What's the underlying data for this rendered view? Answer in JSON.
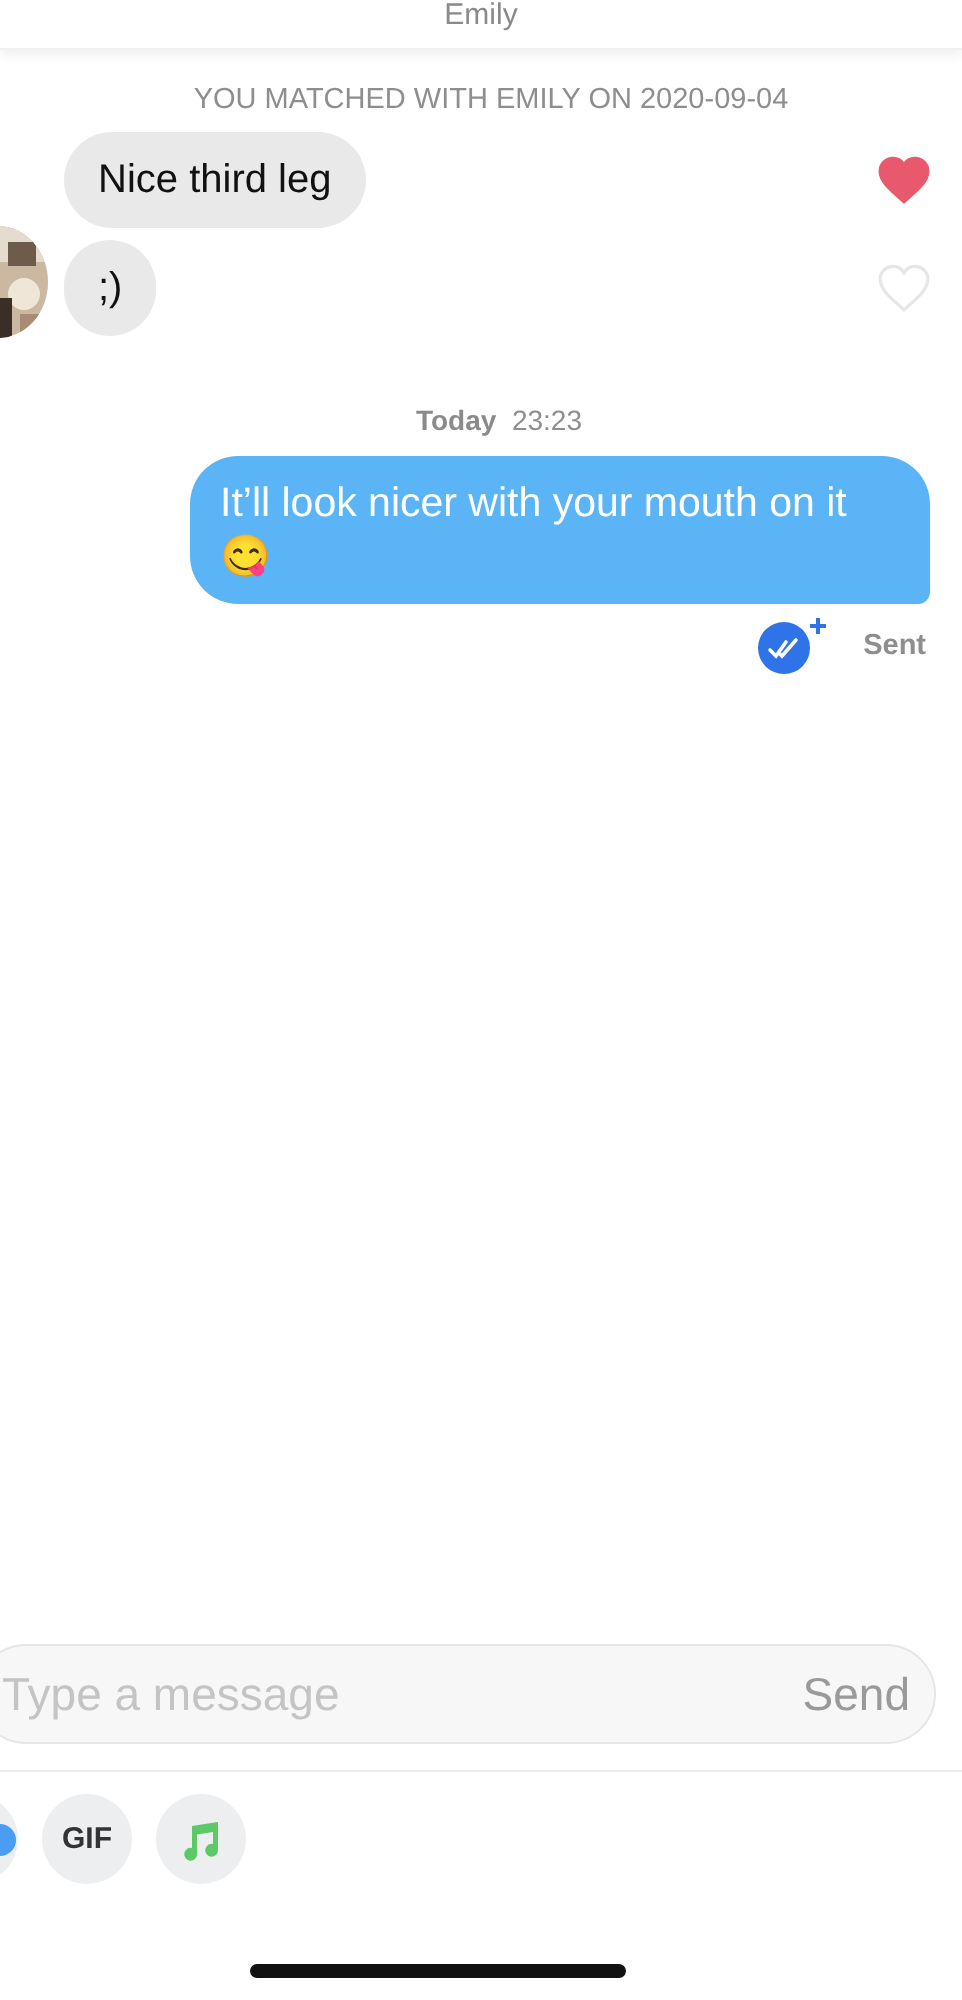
{
  "header": {
    "title": "Emily"
  },
  "match_notice": "YOU MATCHED WITH EMILY ON 2020-09-04",
  "incoming": [
    {
      "text": "Nice third leg",
      "liked": true
    },
    {
      "text": ";)",
      "liked": false
    }
  ],
  "timestamp": {
    "day": "Today",
    "time": "23:23"
  },
  "outgoing": [
    {
      "text": "It’ll look nicer with your mouth on it 😋"
    }
  ],
  "status": {
    "label": "Sent"
  },
  "composer": {
    "placeholder": "Type a message",
    "send": "Send"
  },
  "attachments": [
    {
      "kind": "partial"
    },
    {
      "kind": "gif",
      "label": "GIF"
    },
    {
      "kind": "music"
    }
  ]
}
